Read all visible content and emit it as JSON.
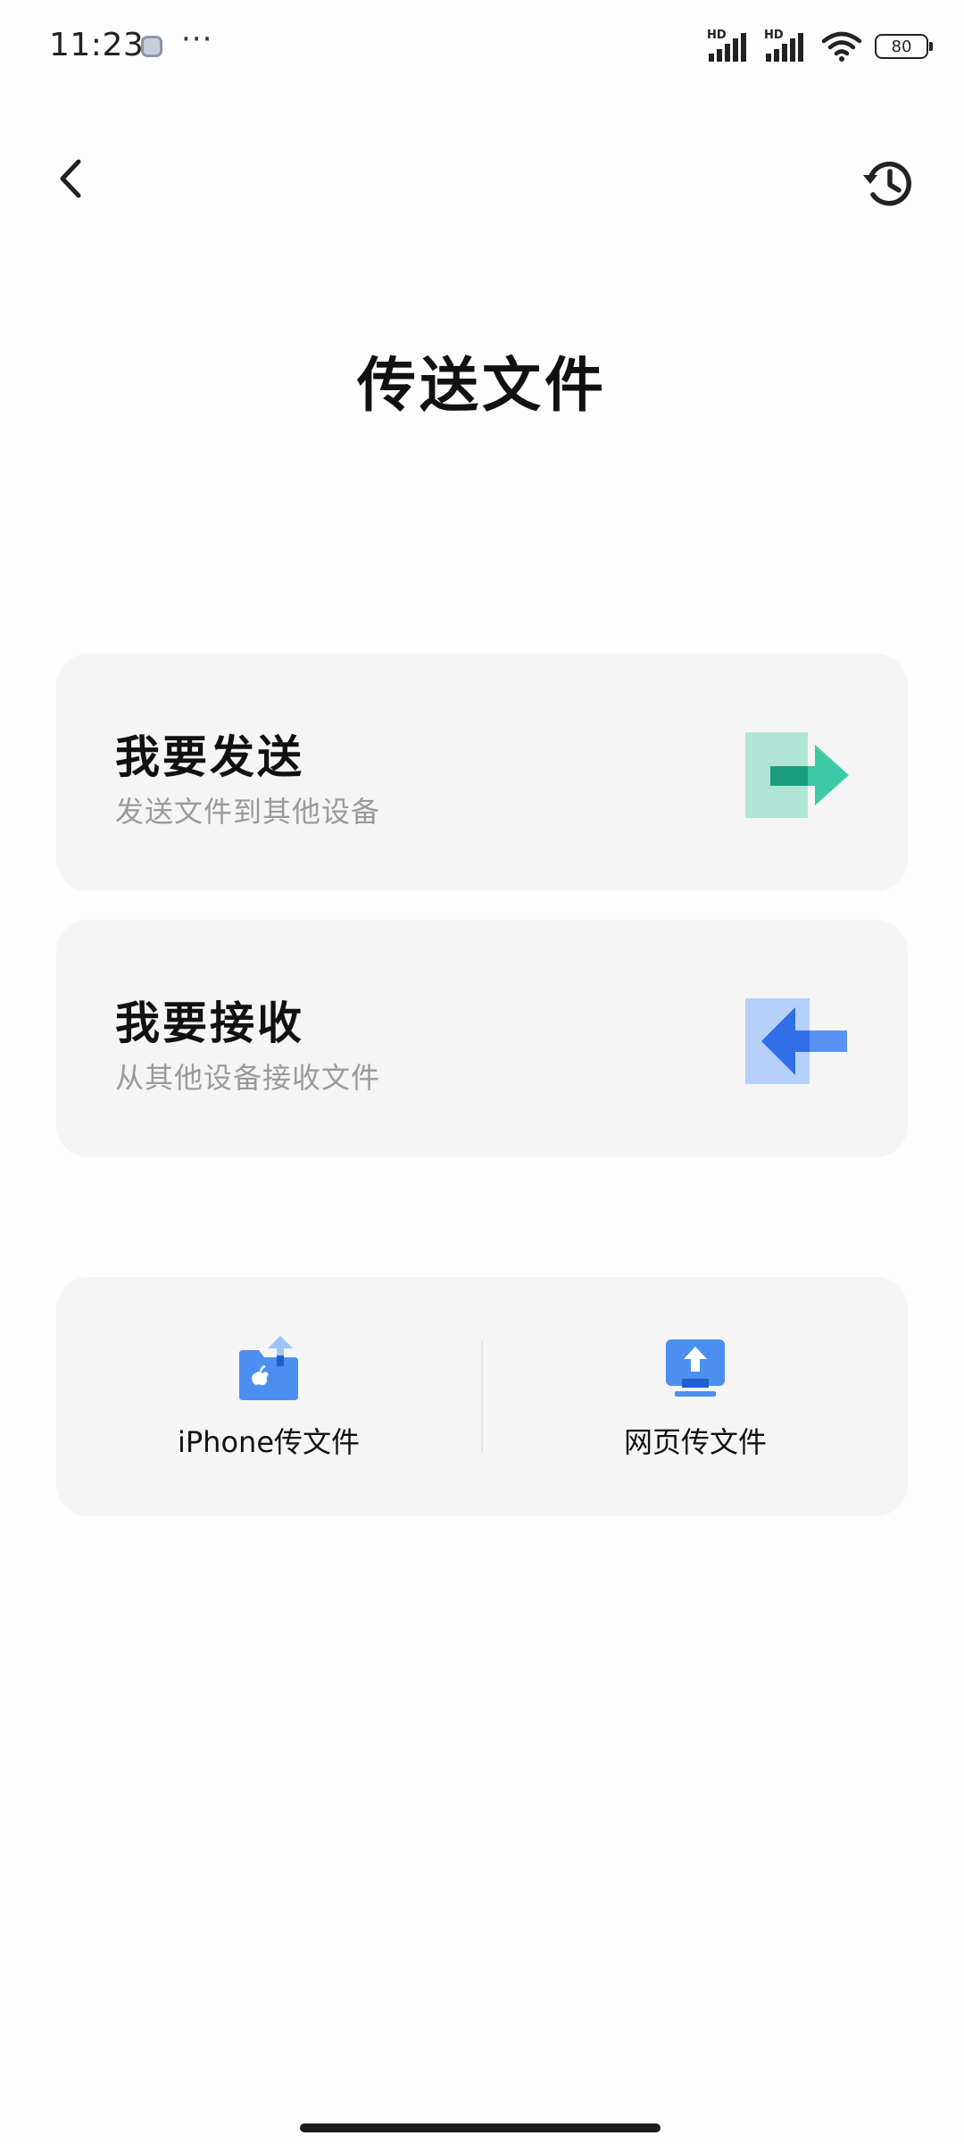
{
  "status_bar": {
    "time": "11:23",
    "more": "···",
    "signal_1_label": "HD",
    "signal_2_label": "HD",
    "battery": "80"
  },
  "header": {
    "back_icon": "chevron-left-icon",
    "history_icon": "history-clock-icon",
    "title": "传送文件"
  },
  "cards": {
    "send": {
      "title": "我要发送",
      "subtitle": "发送文件到其他设备",
      "icon": "send-arrow-icon",
      "color": "#3ccba6"
    },
    "receive": {
      "title": "我要接收",
      "subtitle": "从其他设备接收文件",
      "icon": "receive-arrow-icon",
      "color": "#2f6ee6"
    }
  },
  "options": {
    "iphone": {
      "label": "iPhone传文件",
      "icon": "iphone-folder-upload-icon"
    },
    "web": {
      "label": "网页传文件",
      "icon": "web-upload-monitor-icon"
    }
  },
  "colors": {
    "background": "#fdfdfd",
    "card_background": "#f5f5f5",
    "subtitle": "#9a9a9a",
    "accent_blue": "#4b8ff0"
  }
}
